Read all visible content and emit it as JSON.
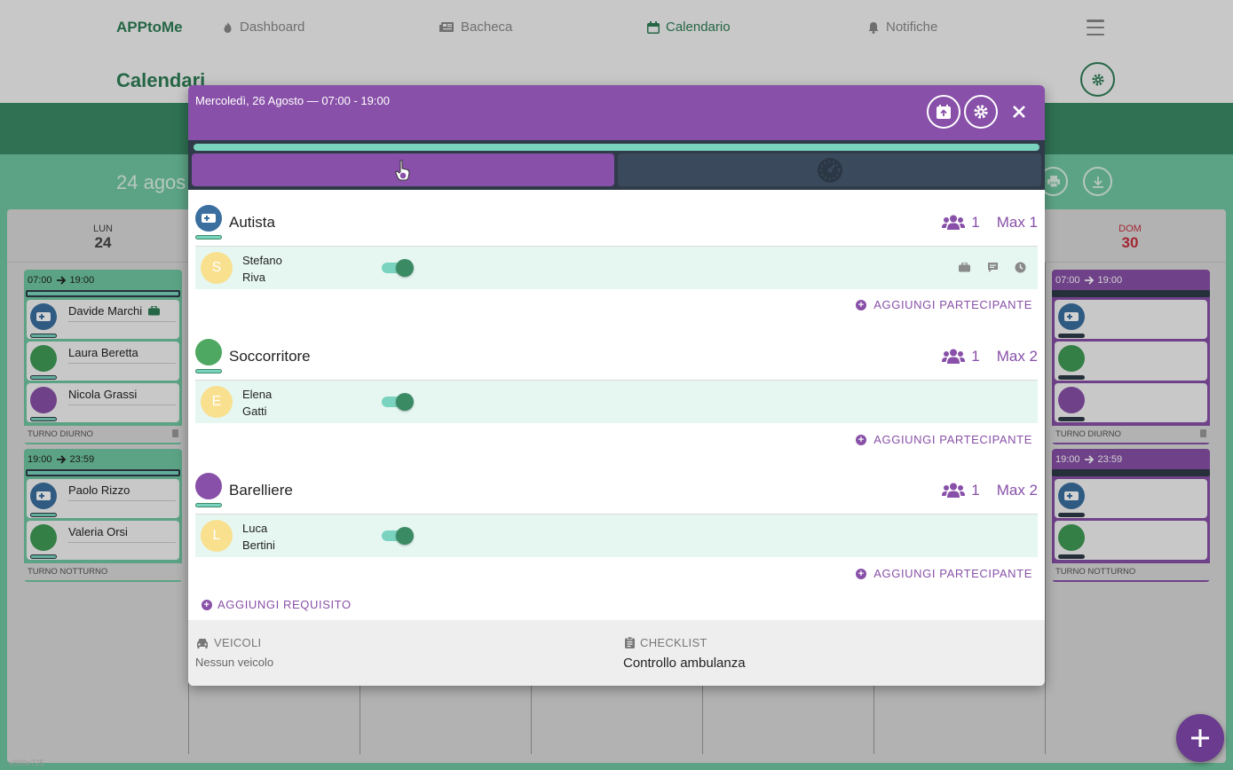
{
  "nav": {
    "brand": "APPtoMe",
    "items": [
      {
        "label": "Dashboard",
        "icon": "fire-icon"
      },
      {
        "label": "Bacheca",
        "icon": "newspaper-icon"
      },
      {
        "label": "Calendario",
        "icon": "calendar-icon"
      },
      {
        "label": "Notifiche",
        "icon": "bell-icon"
      }
    ]
  },
  "page": {
    "title": "Calendari",
    "week_title": "24 agos"
  },
  "calendar": {
    "columns": [
      {
        "dow": "LUN",
        "day": "24"
      },
      {
        "dow": "DOM",
        "day": "30"
      }
    ],
    "monday_shifts": [
      {
        "time_from": "07:00",
        "time_to": "19:00",
        "people": [
          "Davide Marchi",
          "Laura Beretta",
          "Nicola Grassi"
        ],
        "label": "TURNO DIURNO"
      },
      {
        "time_from": "19:00",
        "time_to": "23:59",
        "people": [
          "Paolo Rizzo",
          "Valeria Orsi"
        ],
        "label": "TURNO NOTTURNO"
      }
    ],
    "sunday_shifts": [
      {
        "time_from": "07:00",
        "time_to": "19:00",
        "label": "TURNO DIURNO"
      },
      {
        "time_from": "19:00",
        "time_to": "23:59",
        "label": "TURNO NOTTURNO"
      }
    ]
  },
  "modal": {
    "title": "Mercoledì, 26 Agosto — 07:00 - 19:00",
    "requirements": [
      {
        "name": "Autista",
        "count": "1",
        "max": "Max 1",
        "participants": [
          {
            "initial": "S",
            "first": "Stefano",
            "last": "Riva"
          }
        ]
      },
      {
        "name": "Soccorritore",
        "count": "1",
        "max": "Max 2",
        "participants": [
          {
            "initial": "E",
            "first": "Elena",
            "last": "Gatti"
          }
        ]
      },
      {
        "name": "Barelliere",
        "count": "1",
        "max": "Max 2",
        "participants": [
          {
            "initial": "L",
            "first": "Luca",
            "last": "Bertini"
          }
        ]
      }
    ],
    "add_participant": "AGGIUNGI PARTECIPANTE",
    "add_requirement": "AGGIUNGI REQUISITO",
    "vehicles_title": "VEICOLI",
    "vehicles_value": "Nessun veicolo",
    "checklist_title": "CHECKLIST",
    "checklist_value": "Controllo ambulanza"
  },
  "version": "v800e725",
  "colors": {
    "primary_green": "#2e7d55",
    "purple": "#8850a8",
    "teal": "#79d3be",
    "dark_bar": "#2f3b49"
  }
}
